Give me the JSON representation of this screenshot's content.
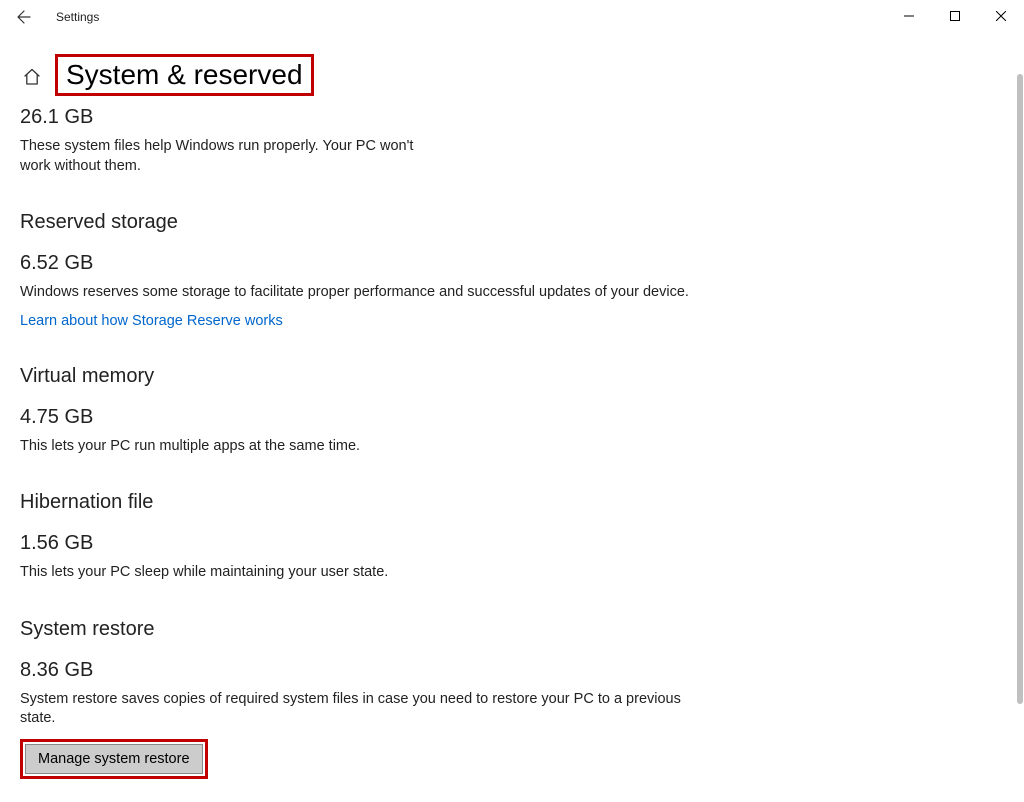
{
  "window": {
    "title": "Settings"
  },
  "page": {
    "title": "System & reserved"
  },
  "system_files": {
    "size": "26.1 GB",
    "description": "These system files help Windows run properly. Your PC won't work without them."
  },
  "reserved_storage": {
    "heading": "Reserved storage",
    "size": "6.52 GB",
    "description": "Windows reserves some storage to facilitate proper performance and successful updates of your device.",
    "link": "Learn about how Storage Reserve works"
  },
  "virtual_memory": {
    "heading": "Virtual memory",
    "size": "4.75 GB",
    "description": "This lets your PC run multiple apps at the same time."
  },
  "hibernation": {
    "heading": "Hibernation file",
    "size": "1.56 GB",
    "description": "This lets your PC sleep while maintaining your user state."
  },
  "system_restore": {
    "heading": "System restore",
    "size": "8.36 GB",
    "description": "System restore saves copies of required system files in case you need to restore your PC to a previous state.",
    "button": "Manage system restore"
  }
}
